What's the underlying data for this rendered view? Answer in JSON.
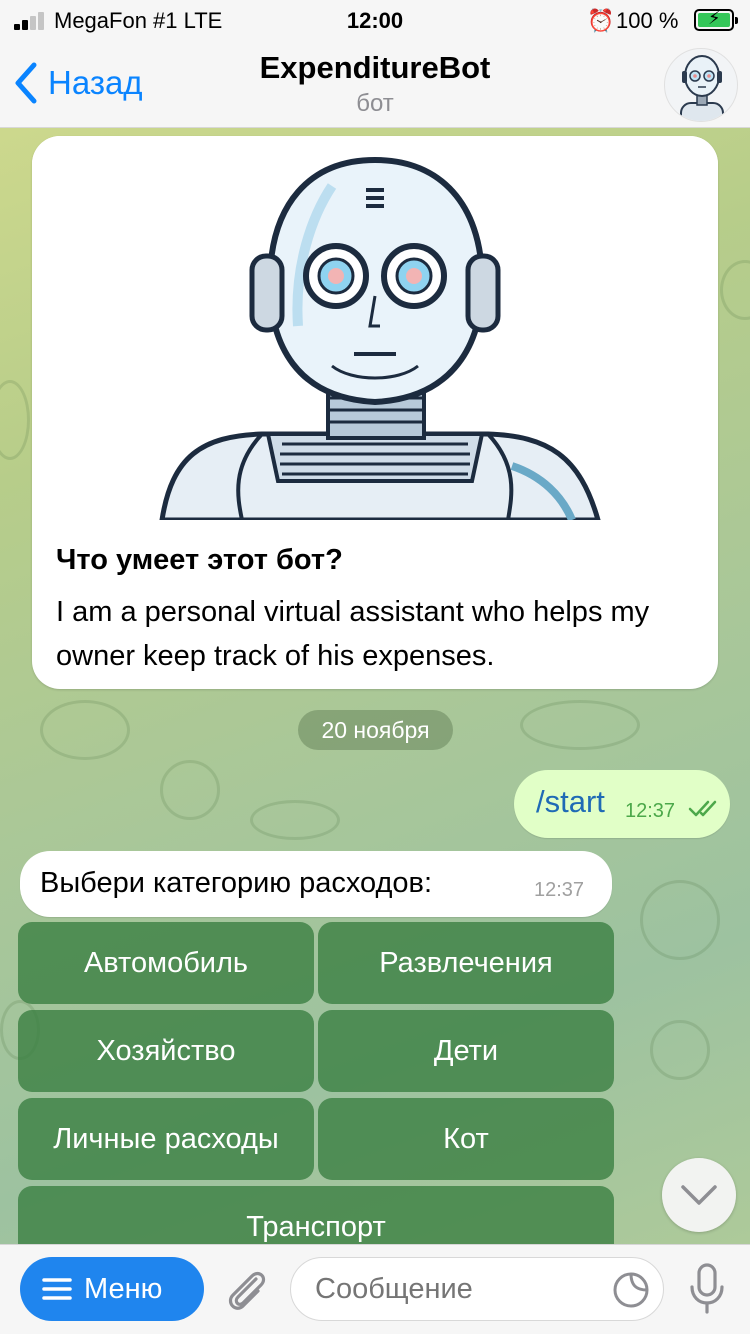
{
  "status_bar": {
    "carrier": "MegaFon #1  LTE",
    "time": "12:00",
    "battery": "100 %"
  },
  "header": {
    "back_label": "Назад",
    "title": "ExpenditureBot",
    "subtitle": "бот",
    "avatar_icon": "robot-avatar-icon"
  },
  "intro": {
    "title": "Что умеет этот бот?",
    "text": "I am a personal virtual assistant who helps my owner keep track of his expenses."
  },
  "messages": {
    "date": "20 ноября",
    "outgoing": {
      "text": "/start",
      "time": "12:37"
    },
    "incoming": {
      "text": "Выбери категорию расходов:",
      "time": "12:37"
    }
  },
  "keyboard": {
    "buttons": [
      "Автомобиль",
      "Развлечения",
      "Хозяйство",
      "Дети",
      "Личные расходы",
      "Кот",
      "Транспорт"
    ]
  },
  "input_bar": {
    "menu_label": "Меню",
    "placeholder": "Сообщение"
  },
  "colors": {
    "accent": "#1f85ee",
    "outgoing_bubble": "#e1ffc7",
    "keyboard_button": "#387d40"
  }
}
